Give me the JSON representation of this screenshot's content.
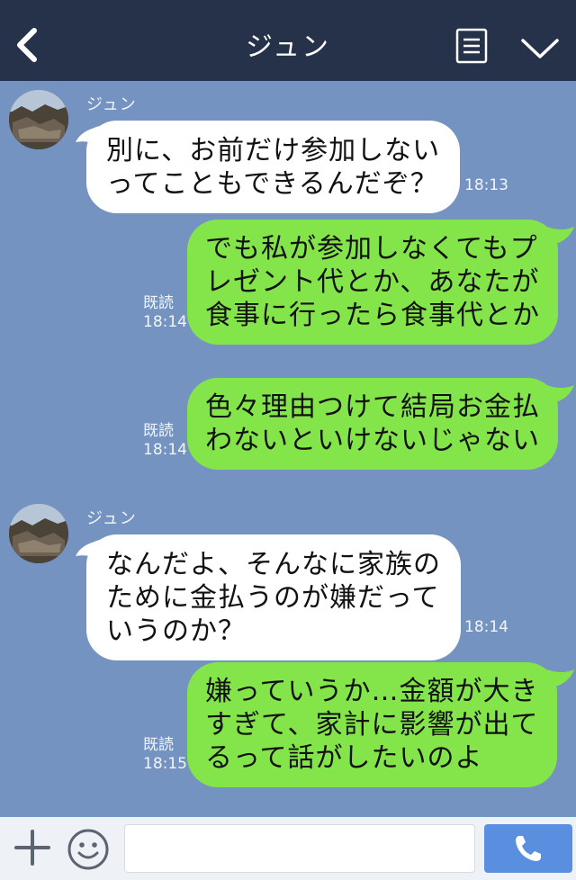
{
  "header": {
    "title": "ジュン"
  },
  "messages": [
    {
      "direction": "in",
      "sender": "ジュン",
      "lines": [
        "別に、お前だけ参加しない",
        "ってこともできるんだぞ？"
      ],
      "time": "18:13"
    },
    {
      "direction": "out",
      "lines": [
        "でも私が参加しなくてもプ",
        "レゼント代とか、あなたが",
        "食事に行ったら食事代とか"
      ],
      "read": "既読",
      "time": "18:14"
    },
    {
      "direction": "out",
      "lines": [
        "色々理由つけて結局お金払",
        "わないといけないじゃない"
      ],
      "read": "既読",
      "time": "18:14"
    },
    {
      "direction": "in",
      "sender": "ジュン",
      "lines": [
        "なんだよ、そんなに家族の",
        "ために金払うのが嫌だって",
        "いうのか？"
      ],
      "time": "18:14"
    },
    {
      "direction": "out",
      "lines": [
        "嫌っていうか…金額が大き",
        "すぎて、家計に影響が出て",
        "るって話がしたいのよ"
      ],
      "read": "既読",
      "time": "18:15"
    }
  ],
  "input": {
    "value": ""
  },
  "colors": {
    "header_bg": "#263249",
    "chat_bg": "#7493c0",
    "incoming_bubble": "#ffffff",
    "outgoing_bubble": "#84e54a",
    "call_button": "#5a8fe0"
  },
  "icons": {
    "back": "chevron-left-icon",
    "menu": "list-icon",
    "collapse": "chevron-down-icon",
    "attach": "plus-icon",
    "emoji": "smiley-icon",
    "call": "phone-icon"
  }
}
